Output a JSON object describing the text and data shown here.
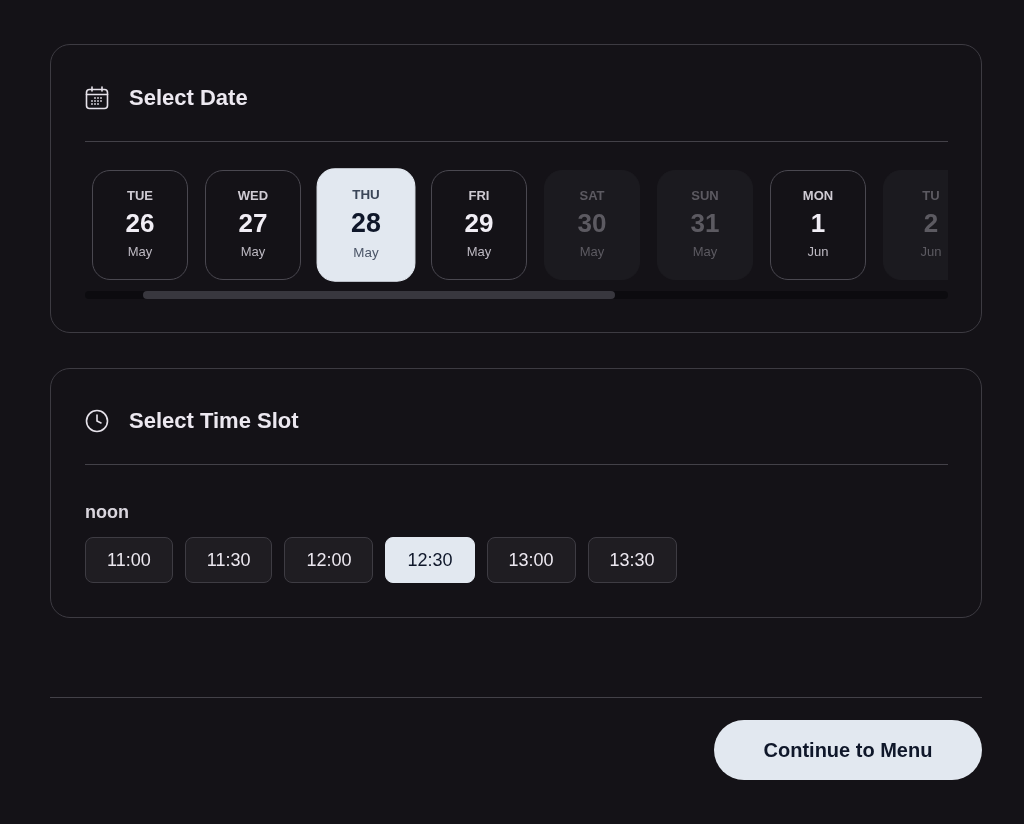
{
  "date_section": {
    "title": "Select Date",
    "dates": [
      {
        "weekday": "TUE",
        "day": "26",
        "month": "May",
        "selected": false,
        "disabled": false
      },
      {
        "weekday": "WED",
        "day": "27",
        "month": "May",
        "selected": false,
        "disabled": false
      },
      {
        "weekday": "THU",
        "day": "28",
        "month": "May",
        "selected": true,
        "disabled": false
      },
      {
        "weekday": "FRI",
        "day": "29",
        "month": "May",
        "selected": false,
        "disabled": false
      },
      {
        "weekday": "SAT",
        "day": "30",
        "month": "May",
        "selected": false,
        "disabled": true
      },
      {
        "weekday": "SUN",
        "day": "31",
        "month": "May",
        "selected": false,
        "disabled": true
      },
      {
        "weekday": "MON",
        "day": "1",
        "month": "Jun",
        "selected": false,
        "disabled": false
      },
      {
        "weekday": "TU",
        "day": "2",
        "month": "Jun",
        "selected": false,
        "disabled": true
      }
    ]
  },
  "time_section": {
    "title": "Select Time Slot",
    "groups": [
      {
        "label": "noon",
        "slots": [
          {
            "label": "11:00",
            "selected": false
          },
          {
            "label": "11:30",
            "selected": false
          },
          {
            "label": "12:00",
            "selected": false
          },
          {
            "label": "12:30",
            "selected": true
          },
          {
            "label": "13:00",
            "selected": false
          },
          {
            "label": "13:30",
            "selected": false
          }
        ]
      }
    ]
  },
  "footer": {
    "button": "Continue to Menu"
  }
}
